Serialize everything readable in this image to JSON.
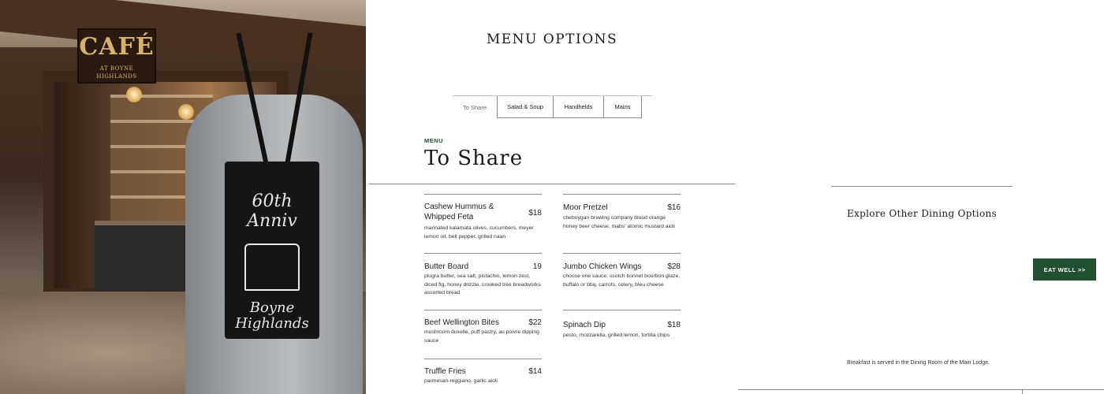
{
  "photo": {
    "sign_main": "CAFÉ",
    "sign_sub": "AT BOYNE HIGHLANDS",
    "tote_line1": "60th Anniv",
    "tote_line2": "Boyne Highlands"
  },
  "header": {
    "title": "MENU OPTIONS"
  },
  "tabs": [
    {
      "label": "To Share",
      "active": true
    },
    {
      "label": "Salad & Soup",
      "active": false
    },
    {
      "label": "Handhelds",
      "active": false
    },
    {
      "label": "Mains",
      "active": false
    }
  ],
  "section": {
    "eyebrow": "MENU",
    "title": "To Share"
  },
  "items": [
    {
      "name": "Cashew Hummus & Whipped Feta",
      "price": "$18",
      "desc": "marinated kalamata olives, cucumbers, meyer lemon oil, bell pepper, grilled naan"
    },
    {
      "name": "Moor Pretzel",
      "price": "$16",
      "desc": "cheboygan brewing company blood orange honey beer cheese, mabs' atomic mustard aioli"
    },
    {
      "name": "Butter Board",
      "price": "19",
      "desc": "plugra butter, sea salt, pistachio, lemon zest, diced fig, honey drizzle, crooked tree breadworks assorted bread"
    },
    {
      "name": "Jumbo Chicken Wings",
      "price": "$28",
      "desc": "choose one sauce: scotch bonnet bourbon glaze, buffalo or bbq, carrots, celery, bleu cheese"
    },
    {
      "name": "Beef Wellington Bites",
      "price": "$22",
      "desc": "mushroom duxelle, puff pastry, au poivre dipping sauce"
    },
    {
      "name": "Spinach Dip",
      "price": "$18",
      "desc": "pesto, mozzarella, grilled lemon, tortilla chips"
    },
    {
      "name": "Truffle Fries",
      "price": "$14",
      "desc": "parmesan-reggiano, garlic aioli"
    }
  ],
  "explore": {
    "title": "Explore Other Dining Options",
    "cta_label": "EAT WELL >>"
  },
  "note": "Breakfast is served in the Dining Room of the Main Lodge.",
  "colors": {
    "accent": "#1f5130",
    "rule": "#8a8a8a"
  }
}
